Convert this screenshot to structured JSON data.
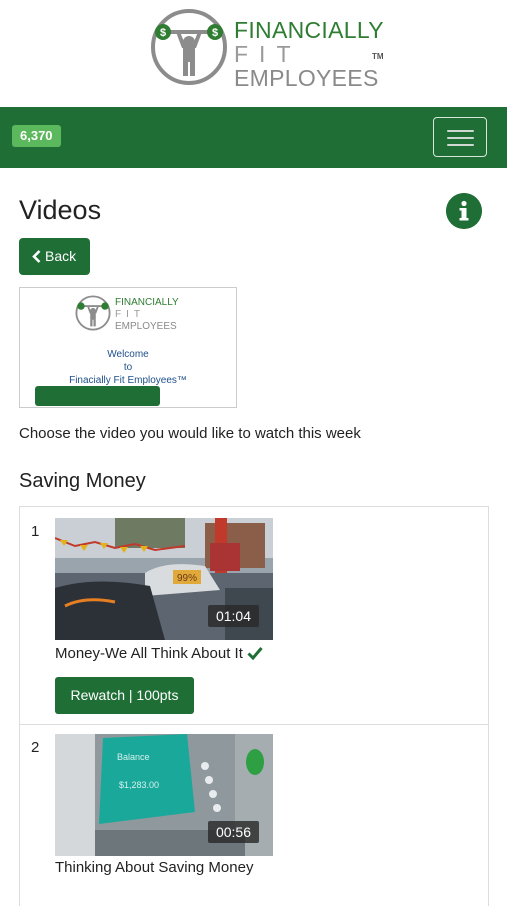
{
  "brand": {
    "line1": "FINANCIALLY",
    "line2": "FIT",
    "line3": "EMPLOYEES",
    "tm": "TM"
  },
  "navbar": {
    "points": "6,370",
    "menu_icon": "hamburger-icon"
  },
  "page": {
    "title": "Videos",
    "info_icon": "info-icon",
    "back_label": "Back",
    "intro": "Choose the video you would like to watch this week"
  },
  "welcome_card": {
    "logo_line1": "FINANCIALLY",
    "logo_line2": "FIT",
    "logo_line3": "EMPLOYEES",
    "line1": "Welcome",
    "line2": "to",
    "line3": "Finacially Fit Employees™"
  },
  "section": {
    "title": "Saving Money",
    "videos": [
      {
        "number": "1",
        "duration": "01:04",
        "title": "Money-We All Think About It",
        "completed": true,
        "button_label": "Rewatch | 100pts",
        "thumb_label": "99%"
      },
      {
        "number": "2",
        "duration": "00:56",
        "title": "Thinking About Saving Money",
        "completed": false,
        "thumb_label1": "Balance",
        "thumb_label2": "$1,283.00"
      }
    ]
  },
  "colors": {
    "brand_green": "#1f6e36",
    "badge_green": "#5cb85c"
  }
}
